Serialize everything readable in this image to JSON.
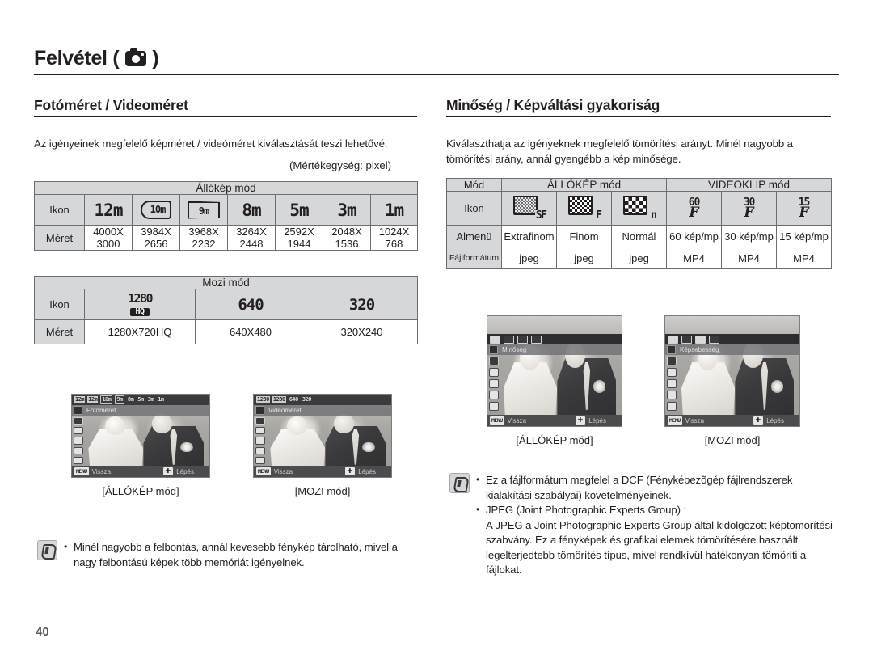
{
  "header": {
    "title": "Felvétel (",
    "title_close": ")",
    "camera_icon": "camera-icon"
  },
  "left_column": {
    "section_title": "Fotóméret / Videoméret",
    "intro": "Az igényeinek megfelelő képméret / videóméret kiválasztását teszi lehetővé.",
    "unit_note": "(Mértékegység: pixel)",
    "still_table": {
      "caption": "Állókép mód",
      "row_labels": [
        "Ikon",
        "Méret"
      ],
      "icons": [
        {
          "type": "seg",
          "text": "12m"
        },
        {
          "type": "rounded",
          "text": "10m"
        },
        {
          "type": "wide",
          "text": "9m"
        },
        {
          "type": "seg",
          "text": "8m"
        },
        {
          "type": "seg",
          "text": "5m"
        },
        {
          "type": "seg",
          "text": "3m"
        },
        {
          "type": "seg",
          "text": "1m"
        }
      ],
      "sizes": [
        [
          "4000X",
          "3000"
        ],
        [
          "3984X",
          "2656"
        ],
        [
          "3968X",
          "2232"
        ],
        [
          "3264X",
          "2448"
        ],
        [
          "2592X",
          "1944"
        ],
        [
          "2048X",
          "1536"
        ],
        [
          "1024X",
          "768"
        ]
      ]
    },
    "movie_table": {
      "caption": "Mozi mód",
      "row_labels": [
        "Ikon",
        "Méret"
      ],
      "icons": [
        {
          "type": "hq",
          "text": "1280",
          "badge": "HQ"
        },
        {
          "type": "seg",
          "text": "640"
        },
        {
          "type": "seg",
          "text": "320"
        }
      ],
      "sizes": [
        "1280X720HQ",
        "640X480",
        "320X240"
      ]
    },
    "screens": [
      {
        "caption": "[ÁLLÓKÉP mód]",
        "menu_title": "Fotóméret",
        "top_icons": [
          "12m",
          "12m",
          "10m",
          "9m",
          "8m",
          "5m",
          "3m",
          "1m"
        ],
        "selected_index": 1,
        "back_label": "Vissza",
        "back_key": "MENU",
        "step_label": "Lépés"
      },
      {
        "caption": "[MOZI mód]",
        "menu_title": "Videoméret",
        "top_icons": [
          "1280",
          "1280",
          "640",
          "320"
        ],
        "selected_index": 1,
        "back_label": "Vissza",
        "back_key": "MENU",
        "step_label": "Lépés"
      }
    ],
    "note": {
      "icon": "note-pen-icon",
      "items": [
        "Minél nagyobb a felbontás, annál kevesebb fénykép tárolható, mivel a nagy felbontású képek több memóriát igényelnek."
      ]
    }
  },
  "right_column": {
    "section_title": "Minőség / Képváltási gyakoriság",
    "intro": "Kiválaszthatja az igényeknek megfelelő tömörítési arányt. Minél nagyobb a tömörítési arány, annál gyengébb a kép minősége.",
    "quality_table": {
      "row_labels": [
        "Mód",
        "Ikon",
        "Almenü",
        "Fájlformátum"
      ],
      "mode_groups": [
        {
          "label": "ÁLLÓKÉP mód",
          "span": 3
        },
        {
          "label": "VIDEOKLIP mód",
          "span": 3
        }
      ],
      "icons": [
        {
          "type": "quality",
          "fill": "sf",
          "letter": "SF"
        },
        {
          "type": "quality",
          "fill": "f",
          "letter": "F"
        },
        {
          "type": "quality",
          "fill": "n",
          "letter": "n"
        },
        {
          "type": "fps",
          "num": "60",
          "letter": "F"
        },
        {
          "type": "fps",
          "num": "30",
          "letter": "F"
        },
        {
          "type": "fps",
          "num": "15",
          "letter": "F"
        }
      ],
      "submenus": [
        "Extrafinom",
        "Finom",
        "Normál",
        "60 kép/mp",
        "30 kép/mp",
        "15 kép/mp"
      ],
      "formats": [
        "jpeg",
        "jpeg",
        "jpeg",
        "MP4",
        "MP4",
        "MP4"
      ]
    },
    "screens": [
      {
        "caption": "[ÁLLÓKÉP mód]",
        "menu_title": "Minőség",
        "sub_count": 4,
        "selected_index": 0,
        "back_label": "Vissza",
        "back_key": "MENU",
        "step_label": "Lépés"
      },
      {
        "caption": "[MOZI mód]",
        "menu_title": "Képsebesség",
        "sub_count": 4,
        "selected_index": 2,
        "back_label": "Vissza",
        "back_key": "MENU",
        "step_label": "Lépés"
      }
    ],
    "note": {
      "icon": "note-pen-icon",
      "items": [
        "Ez a fájlformátum megfelel a DCF (Fényképezõgép fájlrendszerek kialakítási szabályai) követelményeinek.",
        "JPEG (Joint Photographic Experts Group) :"
      ],
      "continuation": "A JPEG a Joint Photographic Experts Group által kidolgozott képtömörítési szabvány. Ez a fényképek és grafikai elemek tömörítésére használt legelterjedtebb tömörítés típus, mivel rendkívül hatékonyan tömöríti a fájlokat."
    }
  },
  "footer": {
    "page_number": "40"
  },
  "colors": {
    "ink": "#231f20",
    "table_header_bg": "#d6d7d8",
    "table_border": "#6d6e71",
    "page_number": "#58595b"
  }
}
